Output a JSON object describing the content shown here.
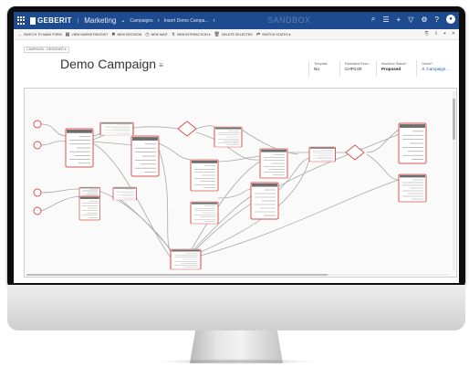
{
  "nav": {
    "brand": "GEBERIT",
    "app": "Marketing",
    "crumb_1": "Campaigns",
    "crumb_2": "Insert Demo Campa...",
    "environment": "SANDBOX"
  },
  "commands": [
    {
      "icon": "→",
      "label": "SWITCH TO MAIN FORM",
      "icon_name": "switch-icon"
    },
    {
      "icon": "▦",
      "label": "VIEW MARKETINGGIST",
      "icon_name": "list-icon"
    },
    {
      "icon": "✖",
      "label": "NEW DECISION",
      "icon_name": "decision-icon"
    },
    {
      "icon": "◷",
      "label": "NEW WAIT",
      "icon_name": "clock-icon"
    },
    {
      "icon": "↯",
      "label": "NEW INTERACTION ▾",
      "icon_name": "interaction-icon"
    },
    {
      "icon": "🗑",
      "label": "DELETE SELECTED",
      "icon_name": "delete-icon"
    },
    {
      "icon": "⇄",
      "label": "SWITCH STATES ▾",
      "icon_name": "switch-states-icon"
    }
  ],
  "header": {
    "breadcrumb_chip": "CAMPAIGN · DESIGNER ▾",
    "title": "Demo Campaign",
    "fields": [
      {
        "label": "Template",
        "value": "No",
        "bold": false
      },
      {
        "label": "Estimated Reve...",
        "value": "CHF0.00",
        "bold": false
      },
      {
        "label": "Workflow Status",
        "value": "Proposed",
        "bold": true
      },
      {
        "label": "Owner",
        "value": "Campaign...",
        "bold": false
      }
    ]
  },
  "colors": {
    "nav": "#1e4b8f",
    "node_border": "#d9534f",
    "node_header": "#6e6e6e",
    "link_line": "#a9a9a9"
  }
}
